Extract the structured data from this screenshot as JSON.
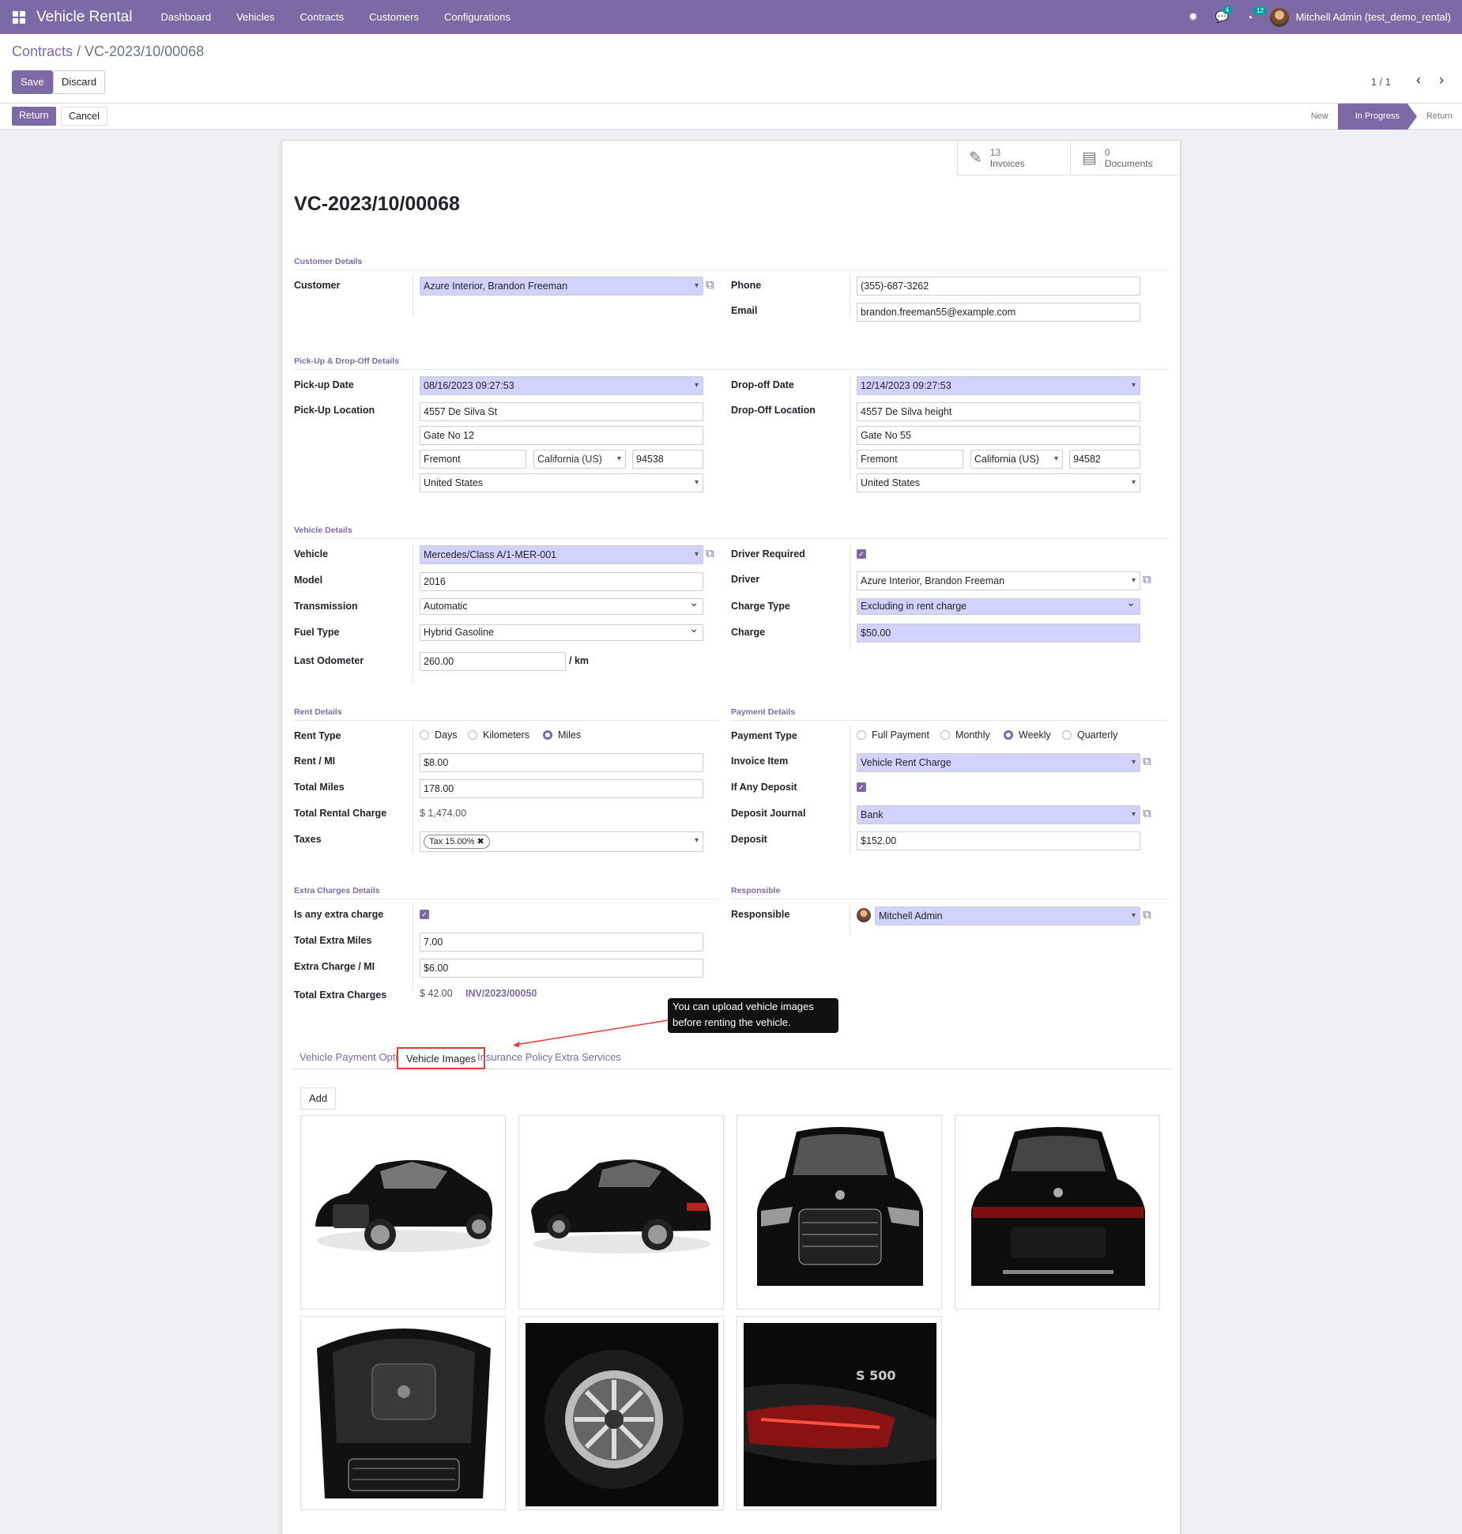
{
  "app": {
    "title": "Vehicle Rental",
    "menu": [
      "Dashboard",
      "Vehicles",
      "Contracts",
      "Customers",
      "Configurations"
    ],
    "chat_count": "4",
    "activity_count": "12",
    "user": "Mitchell Admin (test_demo_rental)"
  },
  "breadcrumb": {
    "parent": "Contracts",
    "current": "VC-2023/10/00068"
  },
  "buttons": {
    "save": "Save",
    "discard": "Discard",
    "return": "Return",
    "cancel": "Cancel",
    "add": "Add"
  },
  "pager": "1 / 1",
  "stages": [
    "New",
    "In Progress",
    "Return"
  ],
  "smart": {
    "invoices_count": "13",
    "invoices_label": "Invoices",
    "documents_count": "0",
    "documents_label": "Documents"
  },
  "record_title": "VC-2023/10/00068",
  "sections": {
    "customer": "Customer Details",
    "pickup": "Pick-Up & Drop-Off Details",
    "vehicle": "Vehicle Details",
    "rent": "Rent Details",
    "payment": "Payment Details",
    "extra": "Extra Charges Details",
    "responsible": "Responsible"
  },
  "labels": {
    "customer": "Customer",
    "phone": "Phone",
    "email": "Email",
    "pickup_date": "Pick-up Date",
    "pickup_location": "Pick-Up Location",
    "dropoff_date": "Drop-off Date",
    "dropoff_location": "Drop-Off Location",
    "vehicle": "Vehicle",
    "model": "Model",
    "transmission": "Transmission",
    "fuel_type": "Fuel Type",
    "last_odometer": "Last Odometer",
    "driver_required": "Driver Required",
    "driver": "Driver",
    "charge_type": "Charge Type",
    "charge": "Charge",
    "rent_type": "Rent Type",
    "rent_mi": "Rent / MI",
    "total_miles": "Total Miles",
    "total_rental_charge": "Total Rental Charge",
    "taxes": "Taxes",
    "payment_type": "Payment Type",
    "invoice_item": "Invoice Item",
    "if_any_deposit": "If Any Deposit",
    "deposit_journal": "Deposit Journal",
    "deposit": "Deposit",
    "is_extra_charge": "Is any extra charge",
    "total_extra_miles": "Total Extra Miles",
    "extra_charge_mi": "Extra Charge / MI",
    "total_extra_charges": "Total Extra Charges",
    "responsible": "Responsible"
  },
  "values": {
    "customer": "Azure Interior, Brandon Freeman",
    "phone": "(355)-687-3262",
    "email": "brandon.freeman55@example.com",
    "pickup_date": "08/16/2023 09:27:53",
    "pickup_street": "4557 De Silva St",
    "pickup_street2": "Gate No 12",
    "pickup_city": "Fremont",
    "pickup_state": "California (US)",
    "pickup_zip": "94538",
    "pickup_country": "United States",
    "dropoff_date": "12/14/2023 09:27:53",
    "dropoff_street": "4557 De Silva height",
    "dropoff_street2": "Gate No 55",
    "dropoff_city": "Fremont",
    "dropoff_state": "California (US)",
    "dropoff_zip": "94582",
    "dropoff_country": "United States",
    "vehicle": "Mercedes/Class A/1-MER-001",
    "model": "2016",
    "transmission": "Automatic",
    "fuel_type": "Hybrid Gasoline",
    "last_odometer": "260.00",
    "odometer_unit": "/ km",
    "driver": "Azure Interior, Brandon Freeman",
    "charge_type": "Excluding in rent charge",
    "charge": "$50.00",
    "rent_types": [
      "Days",
      "Kilometers",
      "Miles"
    ],
    "rent_type_selected": "Miles",
    "rent_mi": "$8.00",
    "total_miles": "178.00",
    "total_rental_charge": "$ 1,474.00",
    "tax_tag": "Tax 15.00%",
    "payment_types": [
      "Full Payment",
      "Monthly",
      "Weekly",
      "Quarterly"
    ],
    "payment_type_selected": "Weekly",
    "invoice_item": "Vehicle Rent Charge",
    "deposit_journal": "Bank",
    "deposit": "$152.00",
    "total_extra_miles": "7.00",
    "extra_charge_mi": "$6.00",
    "total_extra_charges": "$ 42.00",
    "extra_invoice": "INV/2023/00050",
    "responsible": "Mitchell Admin"
  },
  "tooltip": "You can upload vehicle images before renting the vehicle.",
  "tabs": [
    "Vehicle Payment Option",
    "Vehicle Images",
    "Insurance Policy",
    "Extra Services"
  ],
  "active_tab": "Vehicle Images",
  "colors": {
    "brand": "#7c6aa6",
    "required_bg": "#d2d2ff",
    "highlight": "#e53935"
  }
}
